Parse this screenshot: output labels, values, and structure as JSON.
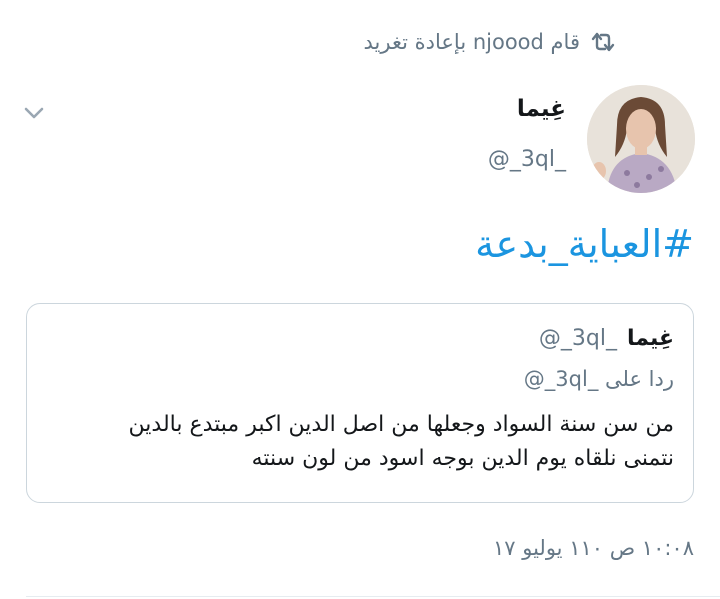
{
  "retweet": {
    "icon": "retweet-icon",
    "text": "قام njoood بإعادة تغريد"
  },
  "tweet": {
    "author_name": "غِيما",
    "author_handle": "@_3ql_",
    "hashtag": "#العباية_بدعة"
  },
  "quoted_tweet": {
    "author_name": "غِيما",
    "author_handle": "@_3ql_",
    "reply_prefix": "ردا على ",
    "reply_handle": "@_3ql_",
    "text_line1": "من سن سنة السواد وجعلها من اصل الدين اكبر مبتدع بالدين",
    "text_line2": "نتمنى نلقاه يوم الدين بوجه اسود من لون سنته"
  },
  "timestamp": "١٠:٠٨ ص ١١٠ يوليو ١٧",
  "colors": {
    "link": "#1b95e0",
    "secondary_text": "#657786",
    "border": "#ccd6dd"
  }
}
